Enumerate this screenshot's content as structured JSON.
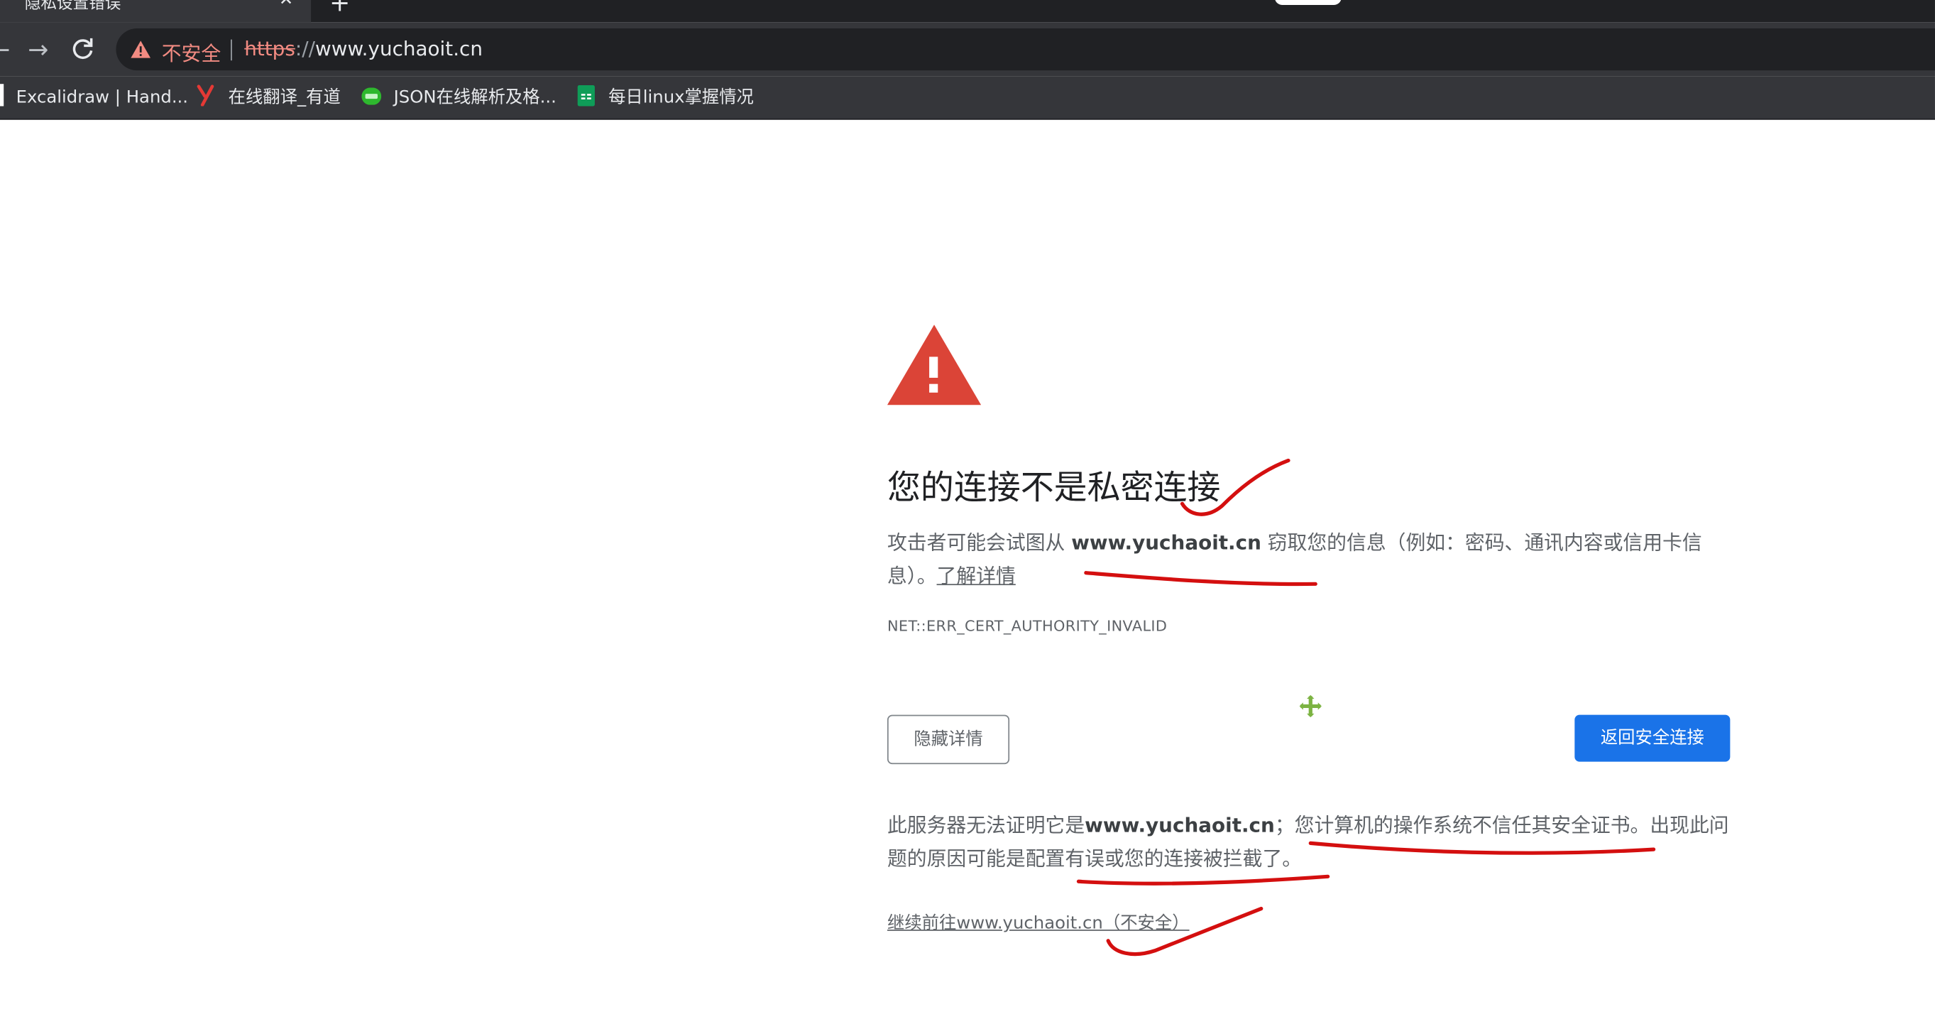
{
  "browser": {
    "tab_title": "隐私设置错误",
    "tab_close_glyph": "✕",
    "new_tab_glyph": "+",
    "back_glyph": "←",
    "forward_glyph": "→",
    "reload_glyph": "↻",
    "security_label": "不安全",
    "url_scheme": "https",
    "url_sep": "://",
    "url_host": "www.yuchaoit.cn",
    "bookmarks": [
      {
        "label": "Excalidraw | Hand...",
        "icon": "excalidraw-icon"
      },
      {
        "label": "在线翻译_有道",
        "icon": "youdao-icon"
      },
      {
        "label": "JSON在线解析及格...",
        "icon": "json-icon"
      },
      {
        "label": "每日linux掌握情况",
        "icon": "sheets-icon"
      }
    ]
  },
  "page": {
    "heading": "您的连接不是私密连接",
    "intro_prefix": "攻击者可能会试图从",
    "intro_host": "www.yuchaoit.cn",
    "intro_suffix": "窃取您的信息（例如：密码、通讯内容或信用卡信息）。",
    "learn_more": "了解详情",
    "error_code": "NET::ERR_CERT_AUTHORITY_INVALID",
    "hide_details_button": "隐藏详情",
    "back_to_safety_button": "返回安全连接",
    "details_prefix": "此服务器无法证明它是",
    "details_host": "www.yuchaoit.cn",
    "details_suffix": "；您计算机的操作系统不信任其安全证书。出现此问题的原因可能是配置有误或您的连接被拦截了。",
    "proceed_link": "继续前往www.yuchaoit.cn（不安全）"
  },
  "colors": {
    "danger_red": "#db4437",
    "primary_blue": "#1a73e8",
    "annotation_red": "#d40f0f",
    "chrome_dark": "#35363a",
    "not_secure_red": "#f28b82"
  }
}
